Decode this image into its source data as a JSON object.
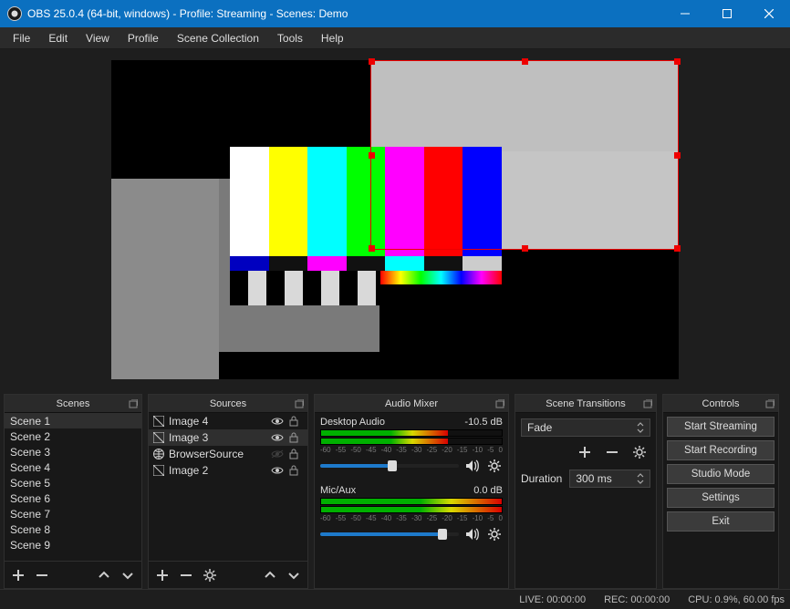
{
  "titlebar": {
    "title": "OBS 25.0.4 (64-bit, windows) - Profile: Streaming - Scenes: Demo"
  },
  "menu": {
    "items": [
      "File",
      "Edit",
      "View",
      "Profile",
      "Scene Collection",
      "Tools",
      "Help"
    ]
  },
  "panels": {
    "scenes": {
      "title": "Scenes",
      "items": [
        "Scene 1",
        "Scene 2",
        "Scene 3",
        "Scene 4",
        "Scene 5",
        "Scene 6",
        "Scene 7",
        "Scene 8",
        "Scene 9"
      ],
      "selected_index": 0
    },
    "sources": {
      "title": "Sources",
      "items": [
        {
          "icon": "image",
          "label": "Image 4",
          "visible": true,
          "locked": false
        },
        {
          "icon": "image",
          "label": "Image 3",
          "visible": true,
          "locked": false
        },
        {
          "icon": "globe",
          "label": "BrowserSource",
          "visible": false,
          "locked": false
        },
        {
          "icon": "image",
          "label": "Image 2",
          "visible": true,
          "locked": false
        }
      ],
      "selected_index": 1
    },
    "mixer": {
      "title": "Audio Mixer",
      "channels": [
        {
          "name": "Desktop Audio",
          "db": "-10.5 dB",
          "ticks": [
            "-60",
            "-55",
            "-50",
            "-45",
            "-40",
            "-35",
            "-30",
            "-25",
            "-20",
            "-15",
            "-10",
            "-5",
            "0"
          ],
          "level_pct": 70,
          "vol_pct": 52
        },
        {
          "name": "Mic/Aux",
          "db": "0.0 dB",
          "ticks": [
            "-60",
            "-55",
            "-50",
            "-45",
            "-40",
            "-35",
            "-30",
            "-25",
            "-20",
            "-15",
            "-10",
            "-5",
            "0"
          ],
          "level_pct": 100,
          "vol_pct": 88
        }
      ]
    },
    "transitions": {
      "title": "Scene Transitions",
      "current": "Fade",
      "duration_label": "Duration",
      "duration_value": "300 ms"
    },
    "controls": {
      "title": "Controls",
      "buttons": [
        "Start Streaming",
        "Start Recording",
        "Studio Mode",
        "Settings",
        "Exit"
      ]
    }
  },
  "status": {
    "live": "LIVE: 00:00:00",
    "rec": "REC: 00:00:00",
    "cpu": "CPU: 0.9%, 60.00 fps"
  }
}
